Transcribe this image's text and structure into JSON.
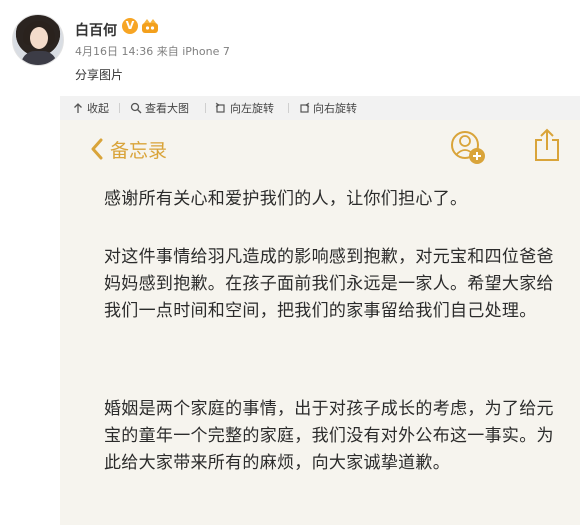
{
  "post": {
    "username": "白百何",
    "verified_label": "V",
    "date": "4月16日 14:36",
    "source_prefix": "来自",
    "source": "iPhone 7",
    "text": "分享图片"
  },
  "toolbar": {
    "collapse": "收起",
    "view_large": "查看大图",
    "rotate_left": "向左旋转",
    "rotate_right": "向右旋转"
  },
  "memo": {
    "back_label": "备忘录",
    "accent_color": "#d9a43a",
    "paragraph_1": "感谢所有关心和爱护我们的人，让你们担心了。",
    "paragraph_2": "对这件事情给羽凡造成的影响感到抱歉，对元宝和四位爸爸妈妈感到抱歉。在孩子面前我们永远是一家人。希望大家给我们一点时间和空间，把我们的家事留给我们自己处理。",
    "paragraph_3": "婚姻是两个家庭的事情，出于对孩子成长的考虑，为了给元宝的童年一个完整的家庭，我们没有对外公布这一事实。为此给大家带来所有的麻烦，向大家诚挚道歉。"
  }
}
